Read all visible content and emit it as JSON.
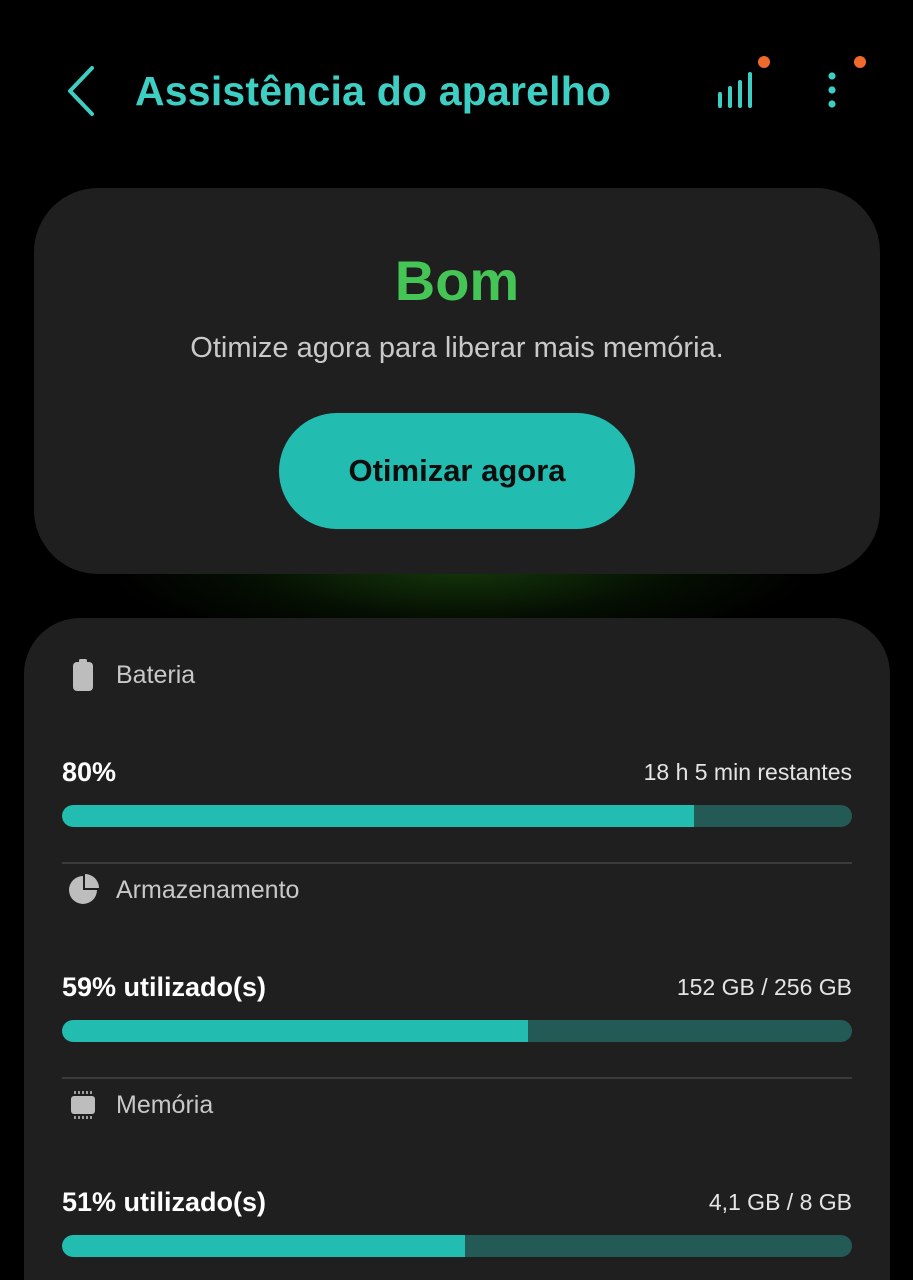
{
  "header": {
    "title": "Assistência do aparelho",
    "back_icon": "chevron-left-icon",
    "signal_icon": "signal-bars-icon",
    "more_icon": "more-vertical-icon",
    "accent_color": "#3ecfc4",
    "notification_dot_color": "#ef6a2b"
  },
  "status": {
    "rating": "Bom",
    "rating_color": "#45c556",
    "message": "Otimize agora para liberar mais memória.",
    "optimize_button": "Otimizar agora"
  },
  "sections": [
    {
      "label": "Bateria",
      "icon": "battery-icon",
      "value": "80%",
      "detail": "18 h 5 min restantes",
      "progress": 0.8
    },
    {
      "label": "Armazenamento",
      "icon": "pie-chart-icon",
      "value": "59% utilizado(s)",
      "detail": "152 GB / 256 GB",
      "progress": 0.59
    },
    {
      "label": "Memória",
      "icon": "memory-chip-icon",
      "value": "51% utilizado(s)",
      "detail": "4,1 GB / 8 GB",
      "progress": 0.51
    }
  ],
  "colors": {
    "bar_fill": "#22bcb0",
    "bar_track": "#235a55",
    "card_background": "#1f1f1f"
  }
}
